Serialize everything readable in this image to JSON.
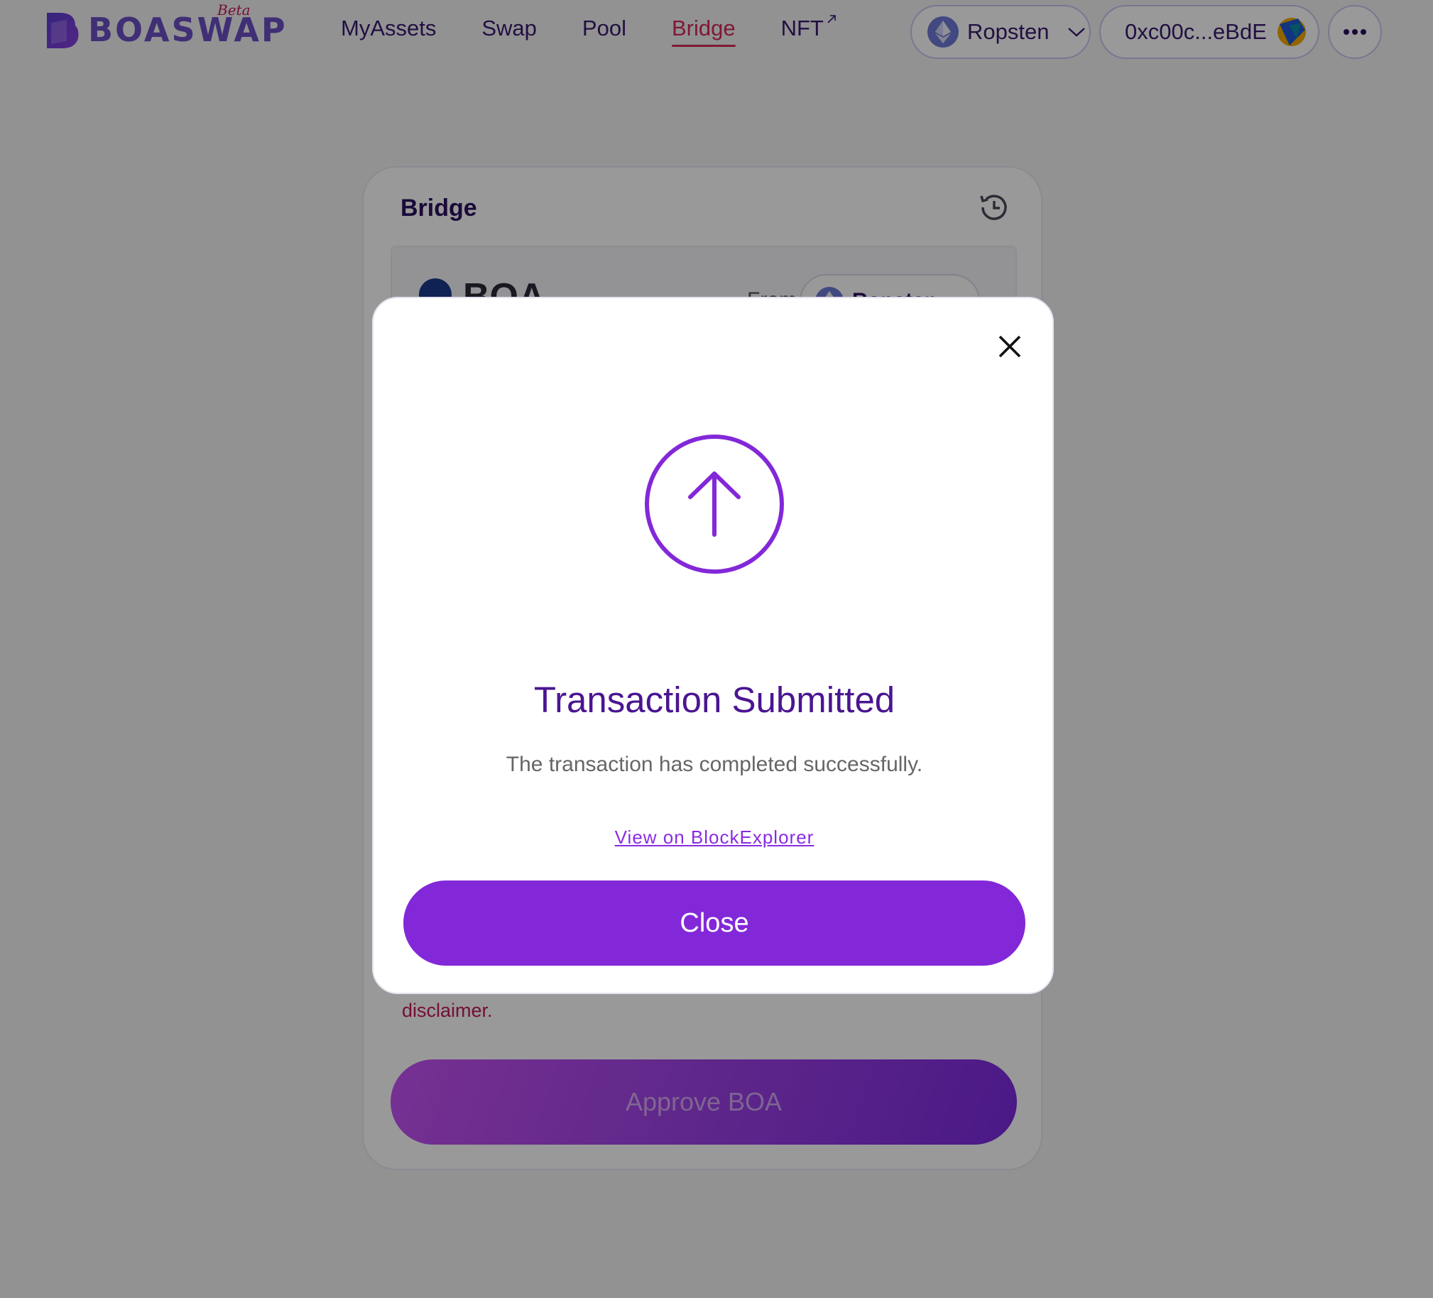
{
  "brand": {
    "name": "BOASWAP",
    "tag": "Beta"
  },
  "nav": {
    "items": [
      {
        "label": "MyAssets"
      },
      {
        "label": "Swap"
      },
      {
        "label": "Pool"
      },
      {
        "label": "Bridge",
        "active": true
      },
      {
        "label": "NFT",
        "external": true
      }
    ]
  },
  "header": {
    "network": "Ropsten",
    "wallet_address": "0xc00c...eBdE"
  },
  "bridge_card": {
    "title": "Bridge",
    "token": "BOA",
    "from_label": "From",
    "from_network": "Ropsten",
    "disclaimer_text": "disclaimer.",
    "approve_label": "Approve BOA"
  },
  "modal": {
    "title": "Transaction Submitted",
    "message": "The transaction has completed successfully.",
    "link_label": "View on BlockExplorer",
    "close_label": "Close"
  },
  "colors": {
    "accent": "#8328d8",
    "heading": "#4a1591",
    "active_nav": "#d32a55",
    "disclaimer": "#c2185b"
  },
  "icons": [
    "boaswap-logo",
    "external-link-icon",
    "ethereum-icon",
    "chevron-down-icon",
    "wallet-avatar-icon",
    "more-icon",
    "history-icon",
    "boa-token-icon",
    "close-icon",
    "arrow-up-circle-icon"
  ]
}
